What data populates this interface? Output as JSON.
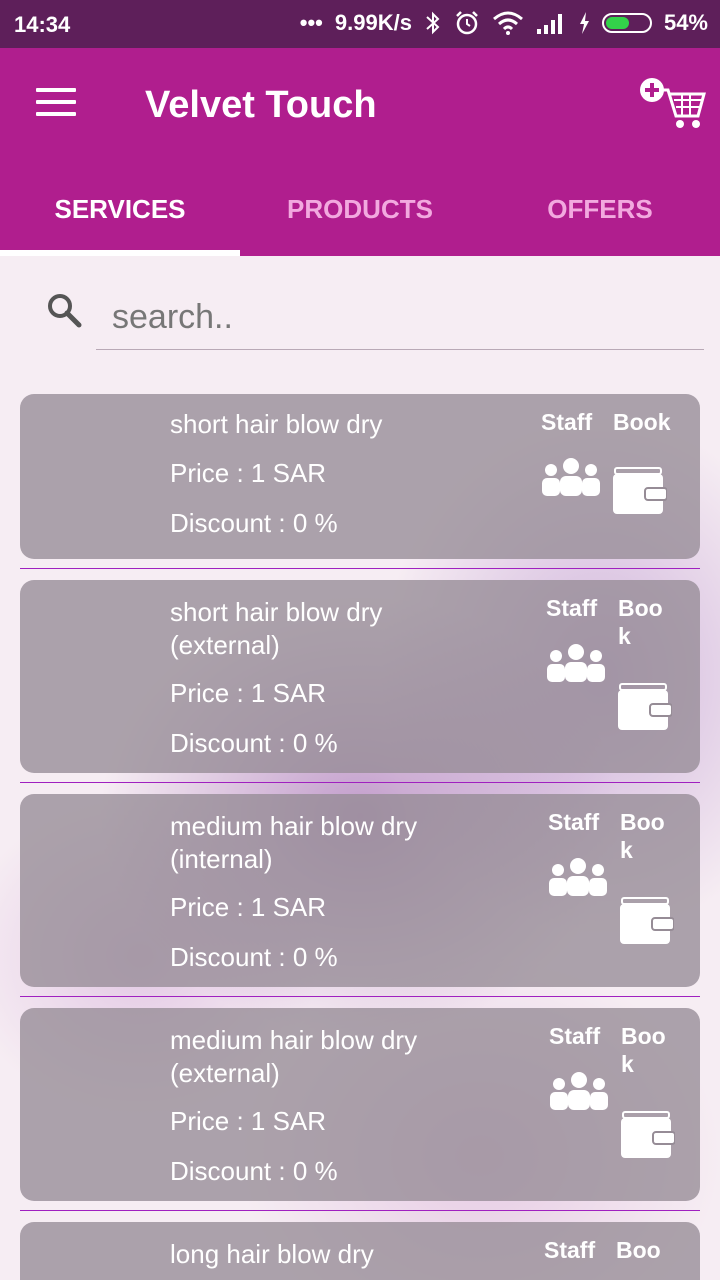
{
  "status": {
    "time": "14:34",
    "dots": "•••",
    "speed": "9.99K/s",
    "battery_percent": "54%",
    "battery_level": 0.54,
    "icons": [
      "bluetooth-icon",
      "alarm-icon",
      "wifi-icon",
      "signal-icon",
      "charging-icon",
      "battery-icon"
    ]
  },
  "appbar": {
    "title": "Velvet Touch",
    "menu_icon": "hamburger-menu-icon",
    "cart_icon": "add-to-cart-icon"
  },
  "tabs": [
    {
      "label": "SERVICES",
      "active": true
    },
    {
      "label": "PRODUCTS",
      "active": false
    },
    {
      "label": "OFFERS",
      "active": false
    }
  ],
  "search": {
    "placeholder": "search.."
  },
  "services": [
    {
      "name": "short hair blow dry",
      "price": "Price : 1 SAR",
      "discount": "Discount : 0 %",
      "staff_label": "Staff",
      "book_label": "Book"
    },
    {
      "name": " short hair blow dry (external)",
      "price": "Price : 1 SAR",
      "discount": "Discount : 0 %",
      "staff_label": "Staff",
      "book_label": "Book"
    },
    {
      "name": "medium hair blow dry (internal)",
      "price": "Price : 1 SAR",
      "discount": "Discount : 0 %",
      "staff_label": "Staff",
      "book_label": "Book"
    },
    {
      "name": "medium hair blow dry (external)",
      "price": "Price : 1 SAR",
      "discount": "Discount : 0 %",
      "staff_label": "Staff",
      "book_label": "Book"
    },
    {
      "name": "long hair blow dry",
      "price": "",
      "discount": "",
      "staff_label": "Staff",
      "book_label": "Boo"
    }
  ],
  "colors": {
    "primary": "#b01e8e",
    "status_bar": "#5e1f5a",
    "tab_inactive": "#f2a9df",
    "card": "#968c96",
    "divider": "#a020c0"
  }
}
